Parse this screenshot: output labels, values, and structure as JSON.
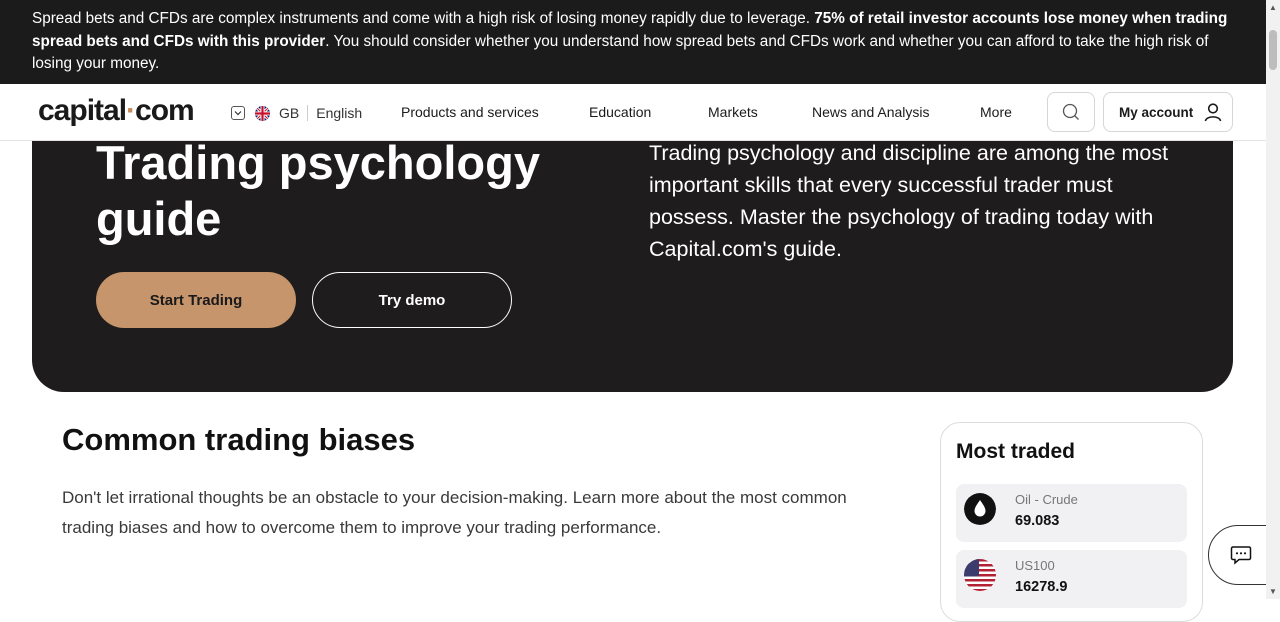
{
  "risk_banner": {
    "text_start": "Spread bets and CFDs are complex instruments and come with a high risk of losing money rapidly due to leverage. ",
    "text_bold": "75% of retail investor accounts lose money when trading spread bets and CFDs with this provider",
    "text_end": ". You should consider whether you understand how spread bets and CFDs work and whether you can afford to take the high risk of losing your money."
  },
  "header": {
    "logo_left": "capital",
    "logo_dot": "·",
    "logo_right": "com",
    "country": "GB",
    "language": "English",
    "nav": [
      "Products and services",
      "Education",
      "Markets",
      "News and Analysis",
      "More"
    ],
    "account_label": "My account"
  },
  "hero": {
    "title": "Trading psychology guide",
    "start_label": "Start Trading",
    "demo_label": "Try demo",
    "description": "Trading psychology and discipline are among the most important skills that every successful trader must possess. Master the psychology of trading today with Capital.com's guide."
  },
  "section": {
    "title": "Common trading biases",
    "description": "Don't let irrational thoughts be an obstacle to your decision-making. Learn more about the most common trading biases and how to overcome them to improve your trading performance."
  },
  "most_traded": {
    "title": "Most traded",
    "items": [
      {
        "name": "Oil - Crude",
        "price": "69.083",
        "icon": "oil-drop-icon"
      },
      {
        "name": "US100",
        "price": "16278.9",
        "icon": "us-flag-icon"
      }
    ]
  },
  "colors": {
    "banner_bg": "#1b1b1b",
    "hero_bg": "#1e1c1c",
    "accent": "#c6956c",
    "logo_dot": "#c68a5c"
  }
}
